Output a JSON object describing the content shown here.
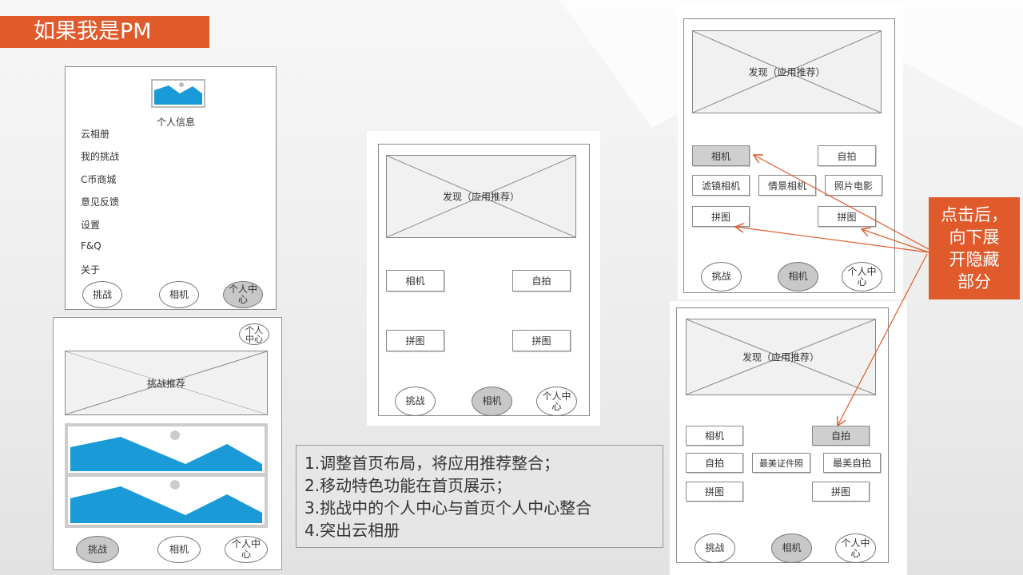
{
  "title": "如果我是PM",
  "menu_screen": {
    "profile": "个人信息",
    "items": [
      "云相册",
      "我的挑战",
      "C币商城",
      "意见反馈",
      "设置",
      "F&Q",
      "关于"
    ],
    "tabs": [
      "挑战",
      "相机",
      "个人中心"
    ]
  },
  "challenge_screen": {
    "profile_button": "个人中心",
    "banner": "挑战推荐",
    "tabs": [
      "挑战",
      "相机",
      "个人中心"
    ]
  },
  "home_screen": {
    "banner": "发现（应用推荐）",
    "buttons": [
      "相机",
      "自拍",
      "拼图",
      "拼图"
    ],
    "tabs": [
      "挑战",
      "相机",
      "个人中心"
    ]
  },
  "camera_expanded": {
    "banner": "发现（应用推荐）",
    "buttons": [
      "相机",
      "自拍",
      "滤镜相机",
      "情景相机",
      "照片电影",
      "拼图",
      "拼图"
    ],
    "tabs": [
      "挑战",
      "相机",
      "个人中心"
    ]
  },
  "selfie_expanded": {
    "banner": "发现（应用推荐）",
    "buttons": [
      "相机",
      "自拍",
      "自拍",
      "最美证件照",
      "最美自拍",
      "拼图",
      "拼图"
    ],
    "tabs": [
      "挑战",
      "相机",
      "个人中心"
    ]
  },
  "notes": [
    "1.调整首页布局，将应用推荐整合；",
    "2.移动特色功能在首页展示；",
    "3.挑战中的个人中心与首页个人中心整合",
    "4.突出云相册"
  ],
  "callout": [
    "点击后，",
    "向下展",
    "开隐藏",
    "部分"
  ],
  "colors": {
    "accent": "#e05a2b",
    "image_blue": "#1a9bd7",
    "selected": "#cfcfcf"
  }
}
